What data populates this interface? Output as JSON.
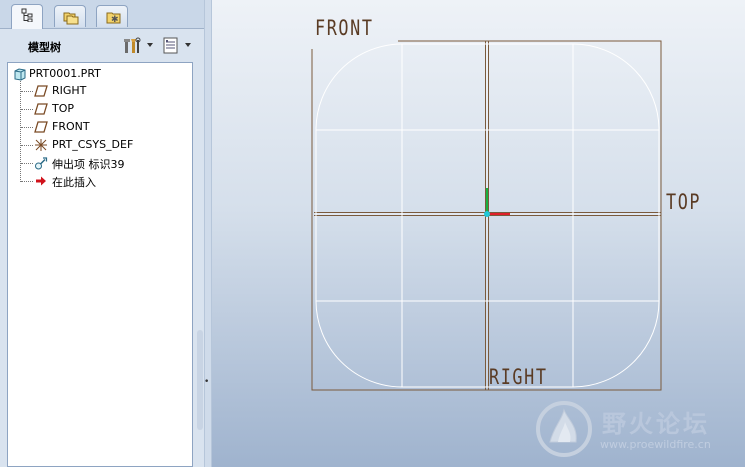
{
  "navigator": {
    "tabs": [
      {
        "name": "model-tree-tab",
        "icon": "tree-icon",
        "active": true
      },
      {
        "name": "folder-browser-tab",
        "icon": "folders-icon",
        "active": false
      },
      {
        "name": "favorites-tab",
        "icon": "star-folder-icon",
        "active": false
      }
    ]
  },
  "tree_header": {
    "title": "模型树",
    "settings_icon": "settings-tools-icon",
    "show_icon": "show-columns-icon"
  },
  "tree": {
    "root": "PRT0001.PRT",
    "items": [
      {
        "label": "RIGHT",
        "icon": "datum-plane-icon"
      },
      {
        "label": "TOP",
        "icon": "datum-plane-icon"
      },
      {
        "label": "FRONT",
        "icon": "datum-plane-icon"
      },
      {
        "label": "PRT_CSYS_DEF",
        "icon": "coordinate-system-icon"
      },
      {
        "label": "伸出项 标识39",
        "icon": "extrude-feature-icon"
      },
      {
        "label": "在此插入",
        "icon": "insert-here-arrow-icon"
      }
    ]
  },
  "graphics": {
    "datum_labels": {
      "front": "FRONT",
      "top": "TOP",
      "right": "RIGHT"
    },
    "colors": {
      "datum_plane": "#7a5a3c",
      "sketch_edge": "#ffffff",
      "csys_x": "#e0202a",
      "csys_y": "#18b040",
      "csys_z": "#20c8d8"
    }
  },
  "watermark": {
    "title": "野火论坛",
    "url": "www.proewildfire.cn"
  }
}
